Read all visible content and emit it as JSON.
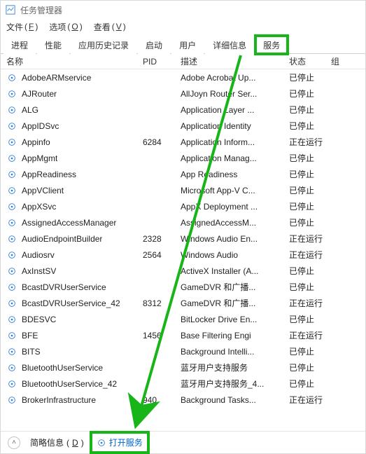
{
  "window": {
    "title": "任务管理器"
  },
  "menu": {
    "file": {
      "label": "文件",
      "hotkey": "F"
    },
    "options": {
      "label": "选项",
      "hotkey": "O"
    },
    "view": {
      "label": "查看",
      "hotkey": "V"
    }
  },
  "tabs": {
    "processes": "进程",
    "performance": "性能",
    "app_history": "应用历史记录",
    "startup": "启动",
    "users": "用户",
    "details": "详细信息",
    "services": "服务"
  },
  "columns": {
    "name": "名称",
    "pid": "PID",
    "desc": "描述",
    "status": "状态",
    "group": "组"
  },
  "statuses": {
    "stopped": "已停止",
    "running": "正在运行"
  },
  "services": [
    {
      "name": "AdobeARMservice",
      "pid": "",
      "desc": "Adobe Acrobat Up...",
      "status": "stopped"
    },
    {
      "name": "AJRouter",
      "pid": "",
      "desc": "AllJoyn Router Ser...",
      "status": "stopped"
    },
    {
      "name": "ALG",
      "pid": "",
      "desc": "Application Layer ...",
      "status": "stopped"
    },
    {
      "name": "AppIDSvc",
      "pid": "",
      "desc": "Application Identity",
      "status": "stopped"
    },
    {
      "name": "Appinfo",
      "pid": "6284",
      "desc": "Application Inform...",
      "status": "running"
    },
    {
      "name": "AppMgmt",
      "pid": "",
      "desc": "Application Manag...",
      "status": "stopped"
    },
    {
      "name": "AppReadiness",
      "pid": "",
      "desc": "App Readiness",
      "status": "stopped"
    },
    {
      "name": "AppVClient",
      "pid": "",
      "desc": "Microsoft App-V C...",
      "status": "stopped"
    },
    {
      "name": "AppXSvc",
      "pid": "",
      "desc": "AppX Deployment ...",
      "status": "stopped"
    },
    {
      "name": "AssignedAccessManager",
      "pid": "",
      "desc": "AssignedAccessM...",
      "status": "stopped"
    },
    {
      "name": "AudioEndpointBuilder",
      "pid": "2328",
      "desc": "Windows Audio En...",
      "status": "running"
    },
    {
      "name": "Audiosrv",
      "pid": "2564",
      "desc": "Windows Audio",
      "status": "running"
    },
    {
      "name": "AxInstSV",
      "pid": "",
      "desc": "ActiveX Installer (A...",
      "status": "stopped"
    },
    {
      "name": "BcastDVRUserService",
      "pid": "",
      "desc": "GameDVR 和广播...",
      "status": "stopped"
    },
    {
      "name": "BcastDVRUserService_42",
      "pid": "8312",
      "desc": "GameDVR 和广播...",
      "status": "running"
    },
    {
      "name": "BDESVC",
      "pid": "",
      "desc": "BitLocker Drive En...",
      "status": "stopped"
    },
    {
      "name": "BFE",
      "pid": "1456",
      "desc": "Base Filtering Engi",
      "status": "running"
    },
    {
      "name": "BITS",
      "pid": "",
      "desc": "Background Intelli...",
      "status": "stopped"
    },
    {
      "name": "BluetoothUserService",
      "pid": "",
      "desc": "蓝牙用户支持服务",
      "status": "stopped"
    },
    {
      "name": "BluetoothUserService_42",
      "pid": "",
      "desc": "蓝牙用户支持服务_4...",
      "status": "stopped"
    },
    {
      "name": "BrokerInfrastructure",
      "pid": "940",
      "desc": "Background Tasks...",
      "status": "running"
    }
  ],
  "footer": {
    "brief_info": "简略信息",
    "brief_hotkey": "D",
    "open_services": "打开服务"
  },
  "annotation_color": "#18b518"
}
